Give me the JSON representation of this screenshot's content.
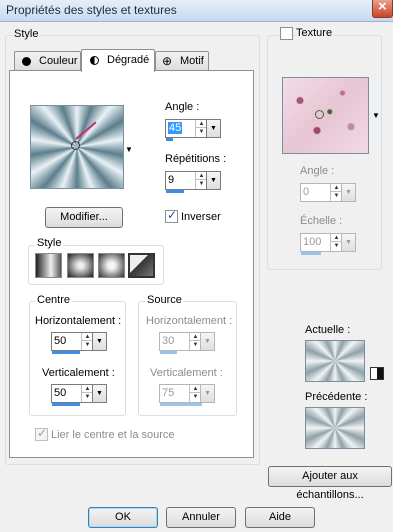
{
  "window": {
    "title": "Propriétés des styles et textures"
  },
  "style_group": {
    "label": "Style"
  },
  "tabs": [
    {
      "label": "Couleur",
      "icon": "filled-circle-icon"
    },
    {
      "label": "Dégradé",
      "icon": "half-circle-icon"
    },
    {
      "label": "Motif",
      "icon": "pattern-cross-icon"
    }
  ],
  "gradient": {
    "angle_label": "Angle :",
    "angle_value": "45",
    "repetitions_label": "Répétitions :",
    "repetitions_value": "9",
    "edit_button": "Modifier...",
    "invert_label": "Inverser",
    "invert_checked": true,
    "style_label": "Style"
  },
  "centre": {
    "label": "Centre",
    "horizontal_label": "Horizontalement :",
    "horizontal_value": "50",
    "vertical_label": "Verticalement :",
    "vertical_value": "50"
  },
  "source": {
    "label": "Source",
    "horizontal_label": "Horizontalement :",
    "horizontal_value": "30",
    "vertical_label": "Verticalement :",
    "vertical_value": "75"
  },
  "link_label": "Lier le centre et la source",
  "texture": {
    "label": "Texture",
    "angle_label": "Angle :",
    "angle_value": "0",
    "scale_label": "Échelle :",
    "scale_value": "100"
  },
  "current_label": "Actuelle :",
  "previous_label": "Précédente :",
  "add_to_swatches_button": "Ajouter aux échantillons...",
  "buttons": {
    "ok": "OK",
    "cancel": "Annuler",
    "help": "Aide"
  },
  "colors": {
    "accent": "#3c8ee6",
    "gradient_dark": "#5b7e8c",
    "gradient_light": "#e9f2f6"
  }
}
